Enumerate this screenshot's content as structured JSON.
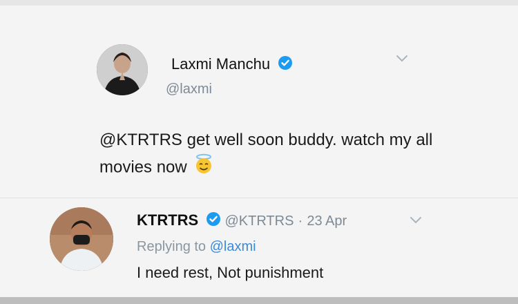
{
  "tweet": {
    "author_name": "Laxmi Manchu",
    "author_handle": "@laxmi",
    "text": "@KTRTRS get well soon buddy. watch my all movies now",
    "emoji_icon": "smiling-face-with-halo-icon"
  },
  "reply": {
    "author_name": "KTRTRS",
    "author_handle": "@KTRTRS",
    "separator": "·",
    "date": "23 Apr",
    "replying_label": "Replying to",
    "replying_handle": "@laxmi",
    "text": "I need rest, Not punishment"
  },
  "colors": {
    "verified": "#1d9bf0",
    "mention": "#3b8ad9",
    "muted": "#7d8a96"
  }
}
